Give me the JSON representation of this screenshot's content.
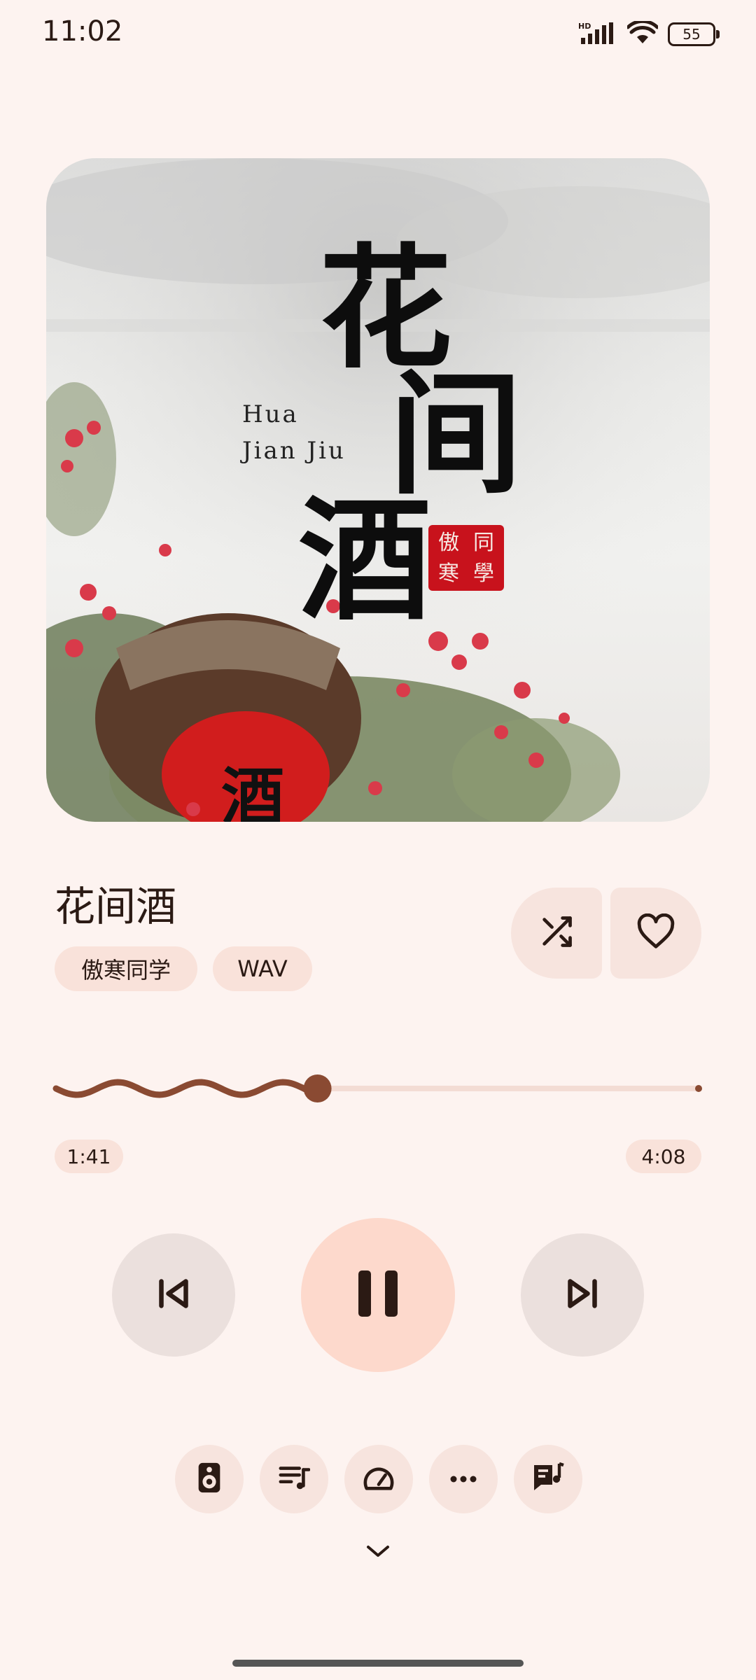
{
  "status_bar": {
    "time": "11:02",
    "battery": "55",
    "network": "HD",
    "icons": [
      "hd-signal-icon",
      "wifi-icon",
      "battery-icon"
    ]
  },
  "album": {
    "latin_title_line1": "Hua",
    "latin_title_line2": "Jian Jiu",
    "calligraphy": [
      "花",
      "间",
      "酒"
    ],
    "seal_chars": [
      "傲",
      "同",
      "寒",
      "學"
    ],
    "jar_character": "酒"
  },
  "track": {
    "title": "花间酒",
    "artist": "傲寒同学",
    "format": "WAV",
    "elapsed": "1:41",
    "duration": "4:08",
    "progress_fraction": 0.407
  },
  "controls": {
    "shuffle_icon": "shuffle-icon",
    "favorite_icon": "heart-icon",
    "previous_icon": "skip-previous-icon",
    "play_state_icon": "pause-icon",
    "next_icon": "skip-next-icon"
  },
  "toolbar": {
    "items": [
      "speaker-icon",
      "playlist-icon",
      "speed-icon",
      "more-icon",
      "lyrics-icon"
    ]
  },
  "colors": {
    "background": "#fdf3f0",
    "accent": "#8a4a32",
    "play_button": "#fdd9cc",
    "track_inactive": "#f3dcd4"
  }
}
